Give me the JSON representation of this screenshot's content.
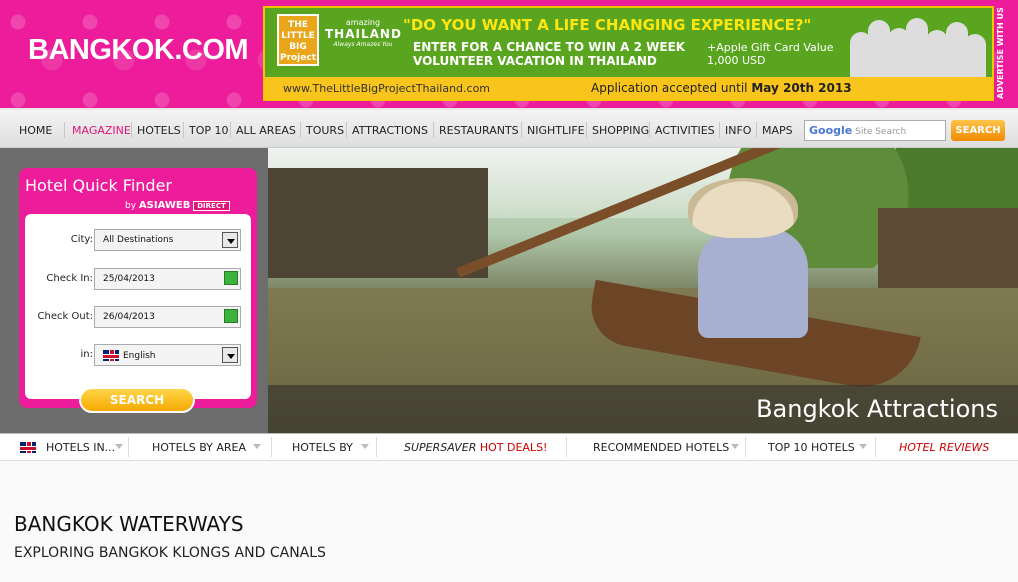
{
  "site": {
    "logo": "BANGKOK.COM"
  },
  "banner": {
    "lbp": "THE LITTLE BIG Project",
    "amazing": "amazing",
    "thailand": "THAILAND",
    "tagline": "Always Amazes You",
    "question": "\"DO YOU WANT A LIFE CHANGING EXPERIENCE?\"",
    "line1": "ENTER FOR A CHANCE TO WIN A 2 WEEK",
    "line2": "VOLUNTEER VACATION IN THAILAND",
    "gift1": "+Apple Gift Card Value",
    "gift2": "1,000 USD",
    "url": "www.TheLittleBigProjectThailand.com",
    "application": "Application accepted until",
    "deadline": "May 20th 2013",
    "advertise": "ADVERTISE WITH US",
    "colors": {
      "green": "#5aa51f",
      "yellow": "#f9c41b",
      "question": "#ffe60f"
    }
  },
  "nav": {
    "items": [
      "HOME",
      "MAGAZINE",
      "HOTELS",
      "TOP 10",
      "ALL AREAS",
      "TOURS",
      "ATTRACTIONS",
      "RESTAURANTS",
      "NIGHTLIFE",
      "SHOPPING",
      "ACTIVITIES",
      "INFO",
      "MAPS"
    ],
    "active": "MAGAZINE",
    "search_placeholder": "Site Search",
    "google": "Google",
    "search_label": "SEARCH"
  },
  "finder": {
    "title": "Hotel Quick Finder",
    "by": "by",
    "brand": "ASIAWEB",
    "brand_tag": "DIRECT",
    "city_label": "City:",
    "city_value": "All Destinations",
    "checkin_label": "Check In:",
    "checkin_value": "25/04/2013",
    "checkout_label": "Check Out:",
    "checkout_value": "26/04/2013",
    "in_label": "in:",
    "language_value": "English",
    "search_label": "SEARCH"
  },
  "hero": {
    "caption": "Bangkok Attractions"
  },
  "subnav": {
    "items": [
      "HOTELS IN...",
      "HOTELS BY AREA",
      "HOTELS BY"
    ],
    "supersaver": "SUPERSAVER",
    "hotdeals": "HOT DEALS!",
    "recommended": "RECOMMENDED HOTELS",
    "top10": "TOP 10 HOTELS",
    "reviews": "HOTEL REVIEWS"
  },
  "content": {
    "title": "BANGKOK WATERWAYS",
    "subtitle": "EXPLORING BANGKOK KLONGS AND CANALS"
  },
  "colors": {
    "brand_pink": "#ec1c9a",
    "accent_red": "#cc0000",
    "orange": "#f6a900"
  }
}
